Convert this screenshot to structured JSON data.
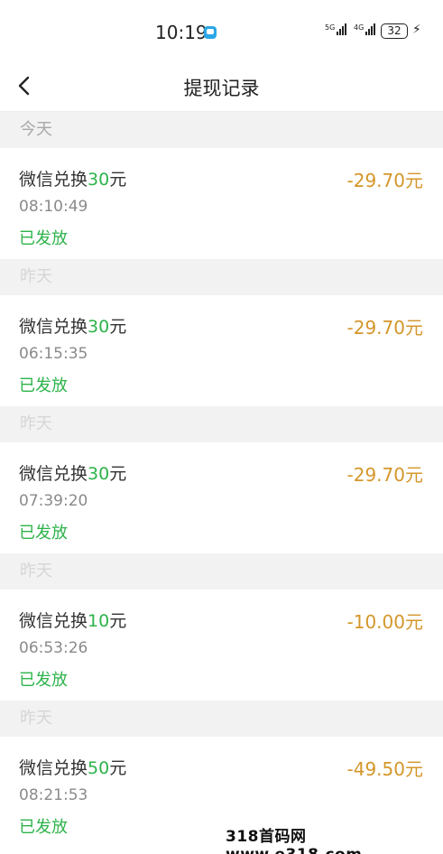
{
  "status_bar": {
    "time": "10:19",
    "signal1_label": "5G",
    "signal2_label": "4G",
    "battery": "32"
  },
  "header": {
    "title": "提现记录"
  },
  "records": [
    {
      "date": "今天",
      "title_prefix": "微信兑换",
      "title_amount": "30",
      "title_suffix": "元",
      "amount": "-29.70元",
      "time": "08:10:49",
      "status": "已发放"
    },
    {
      "date": "昨天",
      "title_prefix": "微信兑换",
      "title_amount": "30",
      "title_suffix": "元",
      "amount": "-29.70元",
      "time": "06:15:35",
      "status": "已发放"
    },
    {
      "date": "昨天",
      "title_prefix": "微信兑换",
      "title_amount": "30",
      "title_suffix": "元",
      "amount": "-29.70元",
      "time": "07:39:20",
      "status": "已发放"
    },
    {
      "date": "昨天",
      "title_prefix": "微信兑换",
      "title_amount": "10",
      "title_suffix": "元",
      "amount": "-10.00元",
      "time": "06:53:26",
      "status": "已发放"
    },
    {
      "date": "昨天",
      "title_prefix": "微信兑换",
      "title_amount": "50",
      "title_suffix": "元",
      "amount": "-49.50元",
      "time": "08:21:53",
      "status": "已发放"
    }
  ],
  "watermark": "318首码网 www.e318.com",
  "colors": {
    "amount": "#d4962a",
    "status_green": "#2db34a",
    "date_header_bg": "#f2f2f2"
  }
}
